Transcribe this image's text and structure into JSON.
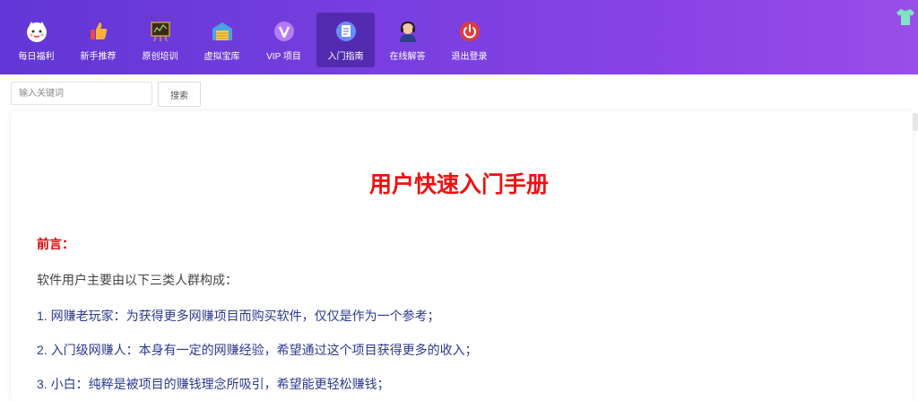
{
  "nav": {
    "items": [
      {
        "label": "每日福利",
        "icon": "lucky-cat-icon",
        "color": "#ffffff"
      },
      {
        "label": "新手推荐",
        "icon": "thumbs-up-icon",
        "color": "#f4a63a"
      },
      {
        "label": "原创培训",
        "icon": "chalkboard-icon",
        "color": "#6b4a2a"
      },
      {
        "label": "虚拟宝库",
        "icon": "warehouse-icon",
        "color": "#4aa3df"
      },
      {
        "label": "VIP 项目",
        "icon": "vip-icon",
        "color": "#b06cf0"
      },
      {
        "label": "入门指南",
        "icon": "document-icon",
        "color": "#5b7bff",
        "active": true
      },
      {
        "label": "在线解答",
        "icon": "support-agent-icon",
        "color": "#2c3e8f"
      },
      {
        "label": "退出登录",
        "icon": "power-icon",
        "color": "#e23a3a"
      }
    ]
  },
  "search": {
    "placeholder": "输入关键词",
    "button_label": "搜索"
  },
  "doc": {
    "title": "用户快速入门手册",
    "preface": "前言：",
    "intro": "软件用户主要由以下三类人群构成：",
    "items": [
      "1. 网赚老玩家：为获得更多网赚项目而购买软件，仅仅是作为一个参考；",
      "2. 入门级网赚人：本身有一定的网赚经验，希望通过这个项目获得更多的收入；",
      "3. 小白：纯粹是被项目的赚钱理念所吸引，希望能更轻松赚钱；"
    ]
  }
}
